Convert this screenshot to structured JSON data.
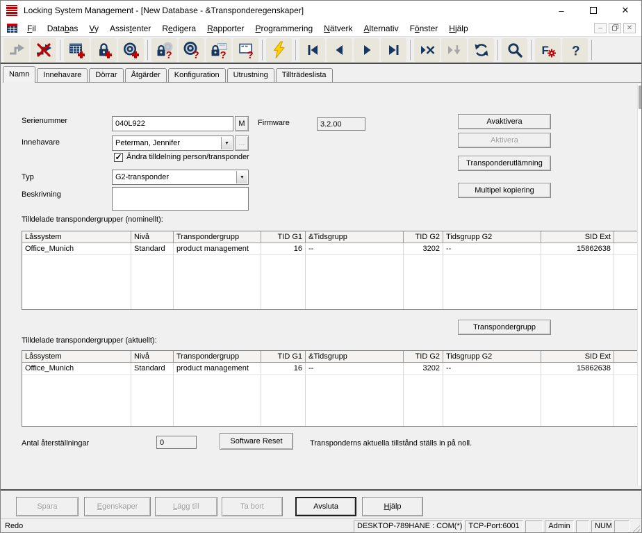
{
  "titlebar": {
    "title": "Locking System Management - [New Database - &Transponderegenskaper]"
  },
  "menubar": {
    "items": [
      {
        "label": "Fil",
        "accel": 0
      },
      {
        "label": "Databas",
        "accel": 4
      },
      {
        "label": "Vy",
        "accel": 0
      },
      {
        "label": "Assistenter",
        "accel": 5
      },
      {
        "label": "Redigera",
        "accel": 1
      },
      {
        "label": "Rapporter",
        "accel": 0
      },
      {
        "label": "Programmering",
        "accel": 0
      },
      {
        "label": "Nätverk",
        "accel": 0
      },
      {
        "label": "Alternativ",
        "accel": 0
      },
      {
        "label": "Fönster",
        "accel": 1
      },
      {
        "label": "Hjälp",
        "accel": 0
      }
    ]
  },
  "toolbar": {
    "buttons": [
      {
        "name": "log-on",
        "icon": "arrow-step",
        "enabled": false
      },
      {
        "name": "log-off",
        "icon": "arrow-step-x",
        "enabled": true
      },
      {
        "sep": true
      },
      {
        "name": "new-locking-system",
        "icon": "table-plus",
        "enabled": true
      },
      {
        "name": "new-lock",
        "icon": "lock-plus",
        "enabled": true
      },
      {
        "name": "new-transponder",
        "icon": "transponder-plus",
        "enabled": true
      },
      {
        "sep": true
      },
      {
        "name": "read-lock",
        "icon": "lock-question",
        "enabled": true
      },
      {
        "name": "read-transponder",
        "icon": "transponder-question",
        "enabled": true
      },
      {
        "name": "read-g1-lock",
        "icon": "lock-card-question",
        "enabled": true
      },
      {
        "name": "read-g1-transponder",
        "icon": "window-question",
        "enabled": true
      },
      {
        "sep": true
      },
      {
        "name": "program",
        "icon": "lightning",
        "enabled": true
      },
      {
        "sep": true
      },
      {
        "name": "first-record",
        "icon": "nav-first",
        "enabled": true
      },
      {
        "name": "previous-record",
        "icon": "nav-prev",
        "enabled": true
      },
      {
        "name": "next-record",
        "icon": "nav-next",
        "enabled": true
      },
      {
        "name": "last-record",
        "icon": "nav-last",
        "enabled": true
      },
      {
        "sep": true
      },
      {
        "name": "remove-record",
        "icon": "play-x",
        "enabled": true
      },
      {
        "name": "import-record",
        "icon": "play-down",
        "enabled": false
      },
      {
        "name": "refresh",
        "icon": "refresh",
        "enabled": true
      },
      {
        "sep": true
      },
      {
        "name": "search",
        "icon": "magnifier",
        "enabled": true
      },
      {
        "sep": true
      },
      {
        "name": "filter",
        "icon": "f-gear",
        "enabled": true
      },
      {
        "name": "help",
        "icon": "question",
        "enabled": true
      },
      {
        "sep": true
      }
    ]
  },
  "tabbar": {
    "active_index": 0,
    "tabs": [
      "Namn",
      "Innehavare",
      "Dörrar",
      "Åtgärder",
      "Konfiguration",
      "Utrustning",
      "Tillträdeslista"
    ]
  },
  "form": {
    "serial_label": "Serienummer",
    "serial_value": "040L922",
    "m_button": "M",
    "firmware_label": "Firmware",
    "firmware_value": "3.2.00",
    "owner_label": "Innehavare",
    "owner_value": "Peterman, Jennifer",
    "browse_button": "...",
    "checkbox_label": "Ändra tilldelning person/transponder",
    "checkbox_checked": true,
    "type_label": "Typ",
    "type_value": "G2-transponder",
    "description_label": "Beskrivning",
    "description_value": ""
  },
  "side_buttons": [
    {
      "label": "Avaktivera",
      "enabled": true
    },
    {
      "label": "Aktivera",
      "enabled": false
    },
    {
      "label": "Transponderutlämning",
      "enabled": true
    },
    {
      "label": "Multipel kopiering",
      "enabled": true
    }
  ],
  "sections": {
    "nominal_title": "Tilldelade transpondergrupper (nominellt):",
    "actual_title": "Tilldelade transpondergrupper (aktuellt):",
    "group_button": "Transpondergrupp"
  },
  "table_columns": [
    {
      "label": "Låssystem",
      "width": 157,
      "align": "left"
    },
    {
      "label": "Nivå",
      "width": 61,
      "align": "left"
    },
    {
      "label": "Transpondergrupp",
      "width": 126,
      "align": "left"
    },
    {
      "label": "TID G1",
      "width": 64,
      "align": "right"
    },
    {
      "label": "&Tidsgrupp",
      "width": 141,
      "align": "left"
    },
    {
      "label": "TID G2",
      "width": 57,
      "align": "right"
    },
    {
      "label": "Tidsgrupp G2",
      "width": 141,
      "align": "left"
    },
    {
      "label": "SID Ext",
      "width": 105,
      "align": "right"
    },
    {
      "label": "",
      "width": 34,
      "align": "left"
    }
  ],
  "tables": {
    "nominal_rows": [
      [
        "Office_Munich",
        "Standard",
        "product management",
        "16",
        "--",
        "3202",
        "--",
        "15862638",
        ""
      ]
    ],
    "actual_rows": [
      [
        "Office_Munich",
        "Standard",
        "product management",
        "16",
        "--",
        "3202",
        "--",
        "15862638",
        ""
      ]
    ]
  },
  "reset_row": {
    "label": "Antal återställningar",
    "value": "0",
    "button_label": "Software Reset",
    "hint": "Transponderns aktuella tillstånd ställs in på noll."
  },
  "bottom_buttons": [
    {
      "label": "Spara",
      "enabled": false,
      "accel": -1
    },
    {
      "label": "Egenskaper",
      "enabled": false,
      "accel": 0
    },
    {
      "label": "Lägg till",
      "enabled": false,
      "accel": 0
    },
    {
      "label": "Ta bort",
      "enabled": false,
      "accel": -1
    },
    {
      "label": "Avsluta",
      "enabled": true,
      "accel": -1,
      "default_btn": true
    },
    {
      "label": "Hjälp",
      "enabled": true,
      "accel": 0
    }
  ],
  "statusbar": {
    "ready_text": "Redo",
    "segments": [
      "DESKTOP-789HANE : COM(*)",
      "TCP-Port:6001",
      "",
      "Admin",
      "",
      "NUM",
      ""
    ]
  }
}
